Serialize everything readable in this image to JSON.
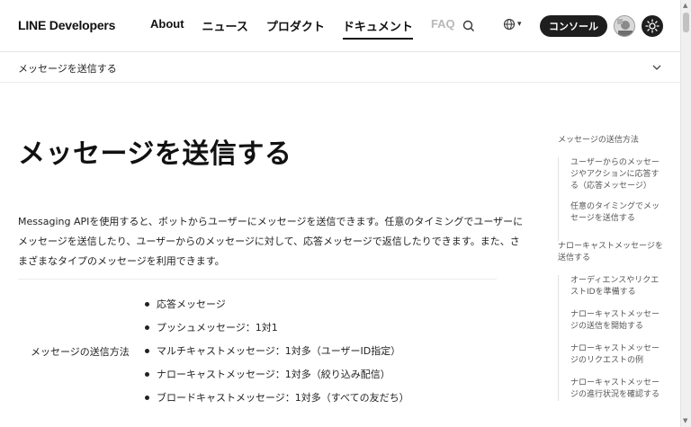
{
  "header": {
    "brand": "LINE Developers",
    "nav": [
      "About",
      "ニュース",
      "プロダクト",
      "ドキュメント",
      "FAQ"
    ],
    "active_nav": "ドキュメント",
    "console_label": "コンソール",
    "icons": {
      "search": "search-icon",
      "language": "globe-icon",
      "theme": "sun-icon"
    }
  },
  "breadcrumb": {
    "current": "メッセージを送信する"
  },
  "main": {
    "title": "メッセージを送信する",
    "intro": "Messaging APIを使用すると、ボットからユーザーにメッセージを送信できます。任意のタイミングでユーザーにメッセージを送信したり、ユーザーからのメッセージに対して、応答メッセージで返信したりできます。また、さまざまなタイプのメッセージを利用できます。",
    "method_label": "メッセージの送信方法",
    "methods": [
      "応答メッセージ",
      "プッシュメッセージ：1対1",
      "マルチキャストメッセージ：1対多（ユーザーID指定）",
      "ナローキャストメッセージ：1対多（絞り込み配信）",
      "ブロードキャストメッセージ：1対多（すべての友だち）"
    ]
  },
  "toc": {
    "sec1": "メッセージの送信方法",
    "sec1_items": [
      "ユーザーからのメッセージやアクションに応答する（応答メッセージ）",
      "任意のタイミングでメッセージを送信する"
    ],
    "sec2": "ナローキャストメッセージを送信する",
    "sec2_items": [
      "オーディエンスやリクエストIDを準備する",
      "ナローキャストメッセージの送信を開始する",
      "ナローキャストメッセージのリクエストの例",
      "ナローキャストメッセージの進行状況を確認する"
    ]
  }
}
